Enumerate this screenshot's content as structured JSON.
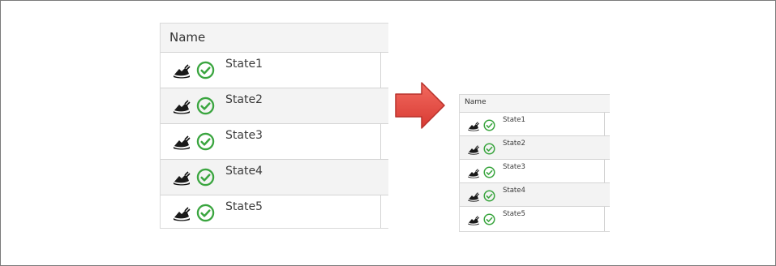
{
  "large_grid": {
    "header": "Name",
    "rows": [
      {
        "label": "State1",
        "status": "ok"
      },
      {
        "label": "State2",
        "status": "ok"
      },
      {
        "label": "State3",
        "status": "ok"
      },
      {
        "label": "State4",
        "status": "ok"
      },
      {
        "label": "State5",
        "status": "ok"
      }
    ]
  },
  "small_grid": {
    "header": "Name",
    "rows": [
      {
        "label": "State1",
        "status": "ok"
      },
      {
        "label": "State2",
        "status": "ok"
      },
      {
        "label": "State3",
        "status": "ok"
      },
      {
        "label": "State4",
        "status": "ok"
      },
      {
        "label": "State5",
        "status": "ok"
      }
    ]
  },
  "icons": {
    "row_type_icon": "plug-connector-icon",
    "row_status_icon": "check-circle-icon",
    "transition_icon": "arrow-right-icon"
  },
  "colors": {
    "check_green": "#3aa53f",
    "arrow_red": "#e8504a",
    "row_alt": "#f3f3f3",
    "header_bg": "#f4f4f4"
  }
}
